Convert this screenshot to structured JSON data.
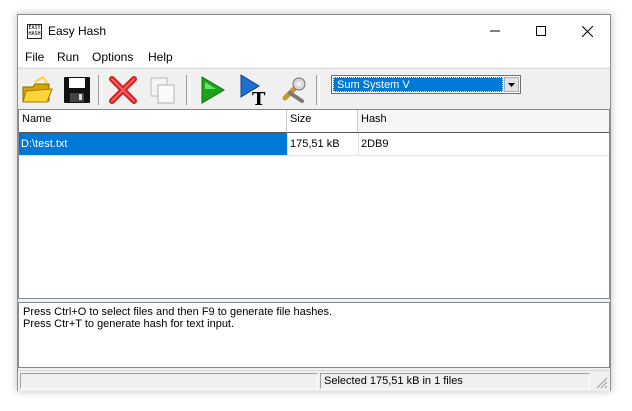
{
  "window": {
    "title": "Easy Hash",
    "icon": "easy-hash-app-icon",
    "icon_text": "EASY HASH"
  },
  "menu": [
    "File",
    "Run",
    "Options",
    "Help"
  ],
  "toolbar": {
    "buttons": [
      {
        "name": "open-folder-icon",
        "title": "Open"
      },
      {
        "name": "save-icon",
        "title": "Save"
      },
      {
        "name": "remove-icon",
        "title": "Remove"
      },
      {
        "name": "copy-icon",
        "title": "Copy"
      },
      {
        "name": "run-icon",
        "title": "Run"
      },
      {
        "name": "text-input-icon",
        "title": "Text"
      },
      {
        "name": "settings-icon",
        "title": "Settings"
      }
    ],
    "algorithm": "Sum System V"
  },
  "list": {
    "columns": [
      "Name",
      "Size",
      "Hash"
    ],
    "rows": [
      {
        "name": "D:\\test.txt",
        "size": "175,51 kB",
        "hash": "2DB9",
        "selected": true
      }
    ]
  },
  "info": {
    "line1": "Press Ctrl+O to select files and then F9 to generate file hashes.",
    "line2": "Press Ctr+T to generate hash for text input."
  },
  "status": {
    "left": "",
    "right": "Selected 175,51 kB in 1 files"
  },
  "colors": {
    "selection": "#0078d7",
    "frame": "#f0f0f0"
  }
}
